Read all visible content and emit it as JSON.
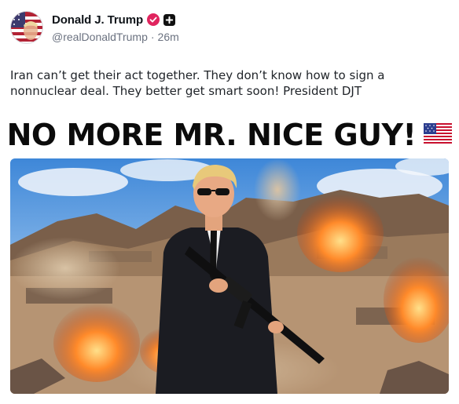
{
  "post": {
    "author": {
      "display_name": "Donald J. Trump",
      "handle": "@realDonaldTrump",
      "separator": "·",
      "timestamp": "26m",
      "avatar_icon": "flag-portrait-avatar",
      "verified_icon": "verified-badge-icon",
      "verified_color": "#e0245e",
      "plus_icon": "plus-badge-icon"
    },
    "text_lines": [
      "Iran can’t get their act together. They don’t know how to sign a",
      "nonnuclear deal. They better get smart soon! President DJT"
    ],
    "media": {
      "headline": "NO MORE MR. NICE GUY!",
      "headline_icon": "us-flag-icon",
      "image_icon": "man-in-suit-with-rifle-explosions-photo"
    }
  }
}
